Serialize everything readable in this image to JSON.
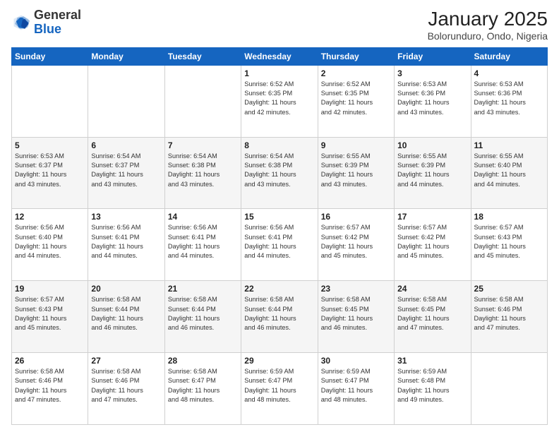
{
  "header": {
    "logo_general": "General",
    "logo_blue": "Blue",
    "month_title": "January 2025",
    "location": "Bolorunduro, Ondo, Nigeria"
  },
  "weekdays": [
    "Sunday",
    "Monday",
    "Tuesday",
    "Wednesday",
    "Thursday",
    "Friday",
    "Saturday"
  ],
  "weeks": [
    [
      {
        "day": "",
        "info": ""
      },
      {
        "day": "",
        "info": ""
      },
      {
        "day": "",
        "info": ""
      },
      {
        "day": "1",
        "info": "Sunrise: 6:52 AM\nSunset: 6:35 PM\nDaylight: 11 hours\nand 42 minutes."
      },
      {
        "day": "2",
        "info": "Sunrise: 6:52 AM\nSunset: 6:35 PM\nDaylight: 11 hours\nand 42 minutes."
      },
      {
        "day": "3",
        "info": "Sunrise: 6:53 AM\nSunset: 6:36 PM\nDaylight: 11 hours\nand 43 minutes."
      },
      {
        "day": "4",
        "info": "Sunrise: 6:53 AM\nSunset: 6:36 PM\nDaylight: 11 hours\nand 43 minutes."
      }
    ],
    [
      {
        "day": "5",
        "info": "Sunrise: 6:53 AM\nSunset: 6:37 PM\nDaylight: 11 hours\nand 43 minutes."
      },
      {
        "day": "6",
        "info": "Sunrise: 6:54 AM\nSunset: 6:37 PM\nDaylight: 11 hours\nand 43 minutes."
      },
      {
        "day": "7",
        "info": "Sunrise: 6:54 AM\nSunset: 6:38 PM\nDaylight: 11 hours\nand 43 minutes."
      },
      {
        "day": "8",
        "info": "Sunrise: 6:54 AM\nSunset: 6:38 PM\nDaylight: 11 hours\nand 43 minutes."
      },
      {
        "day": "9",
        "info": "Sunrise: 6:55 AM\nSunset: 6:39 PM\nDaylight: 11 hours\nand 43 minutes."
      },
      {
        "day": "10",
        "info": "Sunrise: 6:55 AM\nSunset: 6:39 PM\nDaylight: 11 hours\nand 44 minutes."
      },
      {
        "day": "11",
        "info": "Sunrise: 6:55 AM\nSunset: 6:40 PM\nDaylight: 11 hours\nand 44 minutes."
      }
    ],
    [
      {
        "day": "12",
        "info": "Sunrise: 6:56 AM\nSunset: 6:40 PM\nDaylight: 11 hours\nand 44 minutes."
      },
      {
        "day": "13",
        "info": "Sunrise: 6:56 AM\nSunset: 6:41 PM\nDaylight: 11 hours\nand 44 minutes."
      },
      {
        "day": "14",
        "info": "Sunrise: 6:56 AM\nSunset: 6:41 PM\nDaylight: 11 hours\nand 44 minutes."
      },
      {
        "day": "15",
        "info": "Sunrise: 6:56 AM\nSunset: 6:41 PM\nDaylight: 11 hours\nand 44 minutes."
      },
      {
        "day": "16",
        "info": "Sunrise: 6:57 AM\nSunset: 6:42 PM\nDaylight: 11 hours\nand 45 minutes."
      },
      {
        "day": "17",
        "info": "Sunrise: 6:57 AM\nSunset: 6:42 PM\nDaylight: 11 hours\nand 45 minutes."
      },
      {
        "day": "18",
        "info": "Sunrise: 6:57 AM\nSunset: 6:43 PM\nDaylight: 11 hours\nand 45 minutes."
      }
    ],
    [
      {
        "day": "19",
        "info": "Sunrise: 6:57 AM\nSunset: 6:43 PM\nDaylight: 11 hours\nand 45 minutes."
      },
      {
        "day": "20",
        "info": "Sunrise: 6:58 AM\nSunset: 6:44 PM\nDaylight: 11 hours\nand 46 minutes."
      },
      {
        "day": "21",
        "info": "Sunrise: 6:58 AM\nSunset: 6:44 PM\nDaylight: 11 hours\nand 46 minutes."
      },
      {
        "day": "22",
        "info": "Sunrise: 6:58 AM\nSunset: 6:44 PM\nDaylight: 11 hours\nand 46 minutes."
      },
      {
        "day": "23",
        "info": "Sunrise: 6:58 AM\nSunset: 6:45 PM\nDaylight: 11 hours\nand 46 minutes."
      },
      {
        "day": "24",
        "info": "Sunrise: 6:58 AM\nSunset: 6:45 PM\nDaylight: 11 hours\nand 47 minutes."
      },
      {
        "day": "25",
        "info": "Sunrise: 6:58 AM\nSunset: 6:46 PM\nDaylight: 11 hours\nand 47 minutes."
      }
    ],
    [
      {
        "day": "26",
        "info": "Sunrise: 6:58 AM\nSunset: 6:46 PM\nDaylight: 11 hours\nand 47 minutes."
      },
      {
        "day": "27",
        "info": "Sunrise: 6:58 AM\nSunset: 6:46 PM\nDaylight: 11 hours\nand 47 minutes."
      },
      {
        "day": "28",
        "info": "Sunrise: 6:58 AM\nSunset: 6:47 PM\nDaylight: 11 hours\nand 48 minutes."
      },
      {
        "day": "29",
        "info": "Sunrise: 6:59 AM\nSunset: 6:47 PM\nDaylight: 11 hours\nand 48 minutes."
      },
      {
        "day": "30",
        "info": "Sunrise: 6:59 AM\nSunset: 6:47 PM\nDaylight: 11 hours\nand 48 minutes."
      },
      {
        "day": "31",
        "info": "Sunrise: 6:59 AM\nSunset: 6:48 PM\nDaylight: 11 hours\nand 49 minutes."
      },
      {
        "day": "",
        "info": ""
      }
    ]
  ]
}
